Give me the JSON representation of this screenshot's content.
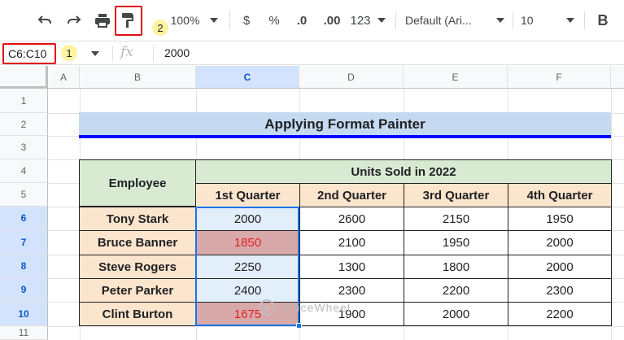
{
  "toolbar": {
    "zoom": "100%",
    "currency": "$",
    "percent": "%",
    "decrease_decimal": ".0",
    "increase_decimal": ".00",
    "number_format": "123",
    "font": "Default (Ari...",
    "font_size": "10",
    "bold": "B",
    "badge_2": "2",
    "icons": [
      "undo-icon",
      "redo-icon",
      "print-icon",
      "paint-format-icon",
      "dropdown-icon",
      "bold-icon"
    ]
  },
  "formula_bar": {
    "name_box": "C6:C10",
    "badge_1": "1",
    "fx": "fx",
    "value": "2000"
  },
  "grid": {
    "columns": [
      "A",
      "B",
      "C",
      "D",
      "E",
      "F"
    ],
    "rows": [
      "1",
      "2",
      "3",
      "4",
      "5",
      "6",
      "7",
      "8",
      "9",
      "10",
      "11"
    ]
  },
  "sheet": {
    "title": "Applying Format Painter",
    "employee_header": "Employee",
    "units_header": "Units Sold in 2022",
    "quarters": [
      "1st Quarter",
      "2nd Quarter",
      "3rd Quarter",
      "4th Quarter"
    ],
    "rows": [
      {
        "name": "Tony Stark",
        "values": [
          "2000",
          "2600",
          "2150",
          "1950"
        ]
      },
      {
        "name": "Bruce Banner",
        "values": [
          "1850",
          "2100",
          "1950",
          "2000"
        ]
      },
      {
        "name": "Steve Rogers",
        "values": [
          "2250",
          "1300",
          "1800",
          "2000"
        ]
      },
      {
        "name": "Peter Parker",
        "values": [
          "2400",
          "2300",
          "2200",
          "2300"
        ]
      },
      {
        "name": "Clint Burton",
        "values": [
          "1675",
          "1900",
          "2000",
          "2200"
        ]
      }
    ]
  },
  "watermark": "OfficeWheel",
  "colors": {
    "selection": "#1a73e8",
    "highlight_red": "#e01010",
    "title_bg": "#c5daf0",
    "header_green": "#d9ead3",
    "header_peach": "#fce5cd",
    "cell_blue": "#e3eefb",
    "cell_red": "#d8a9ab"
  }
}
